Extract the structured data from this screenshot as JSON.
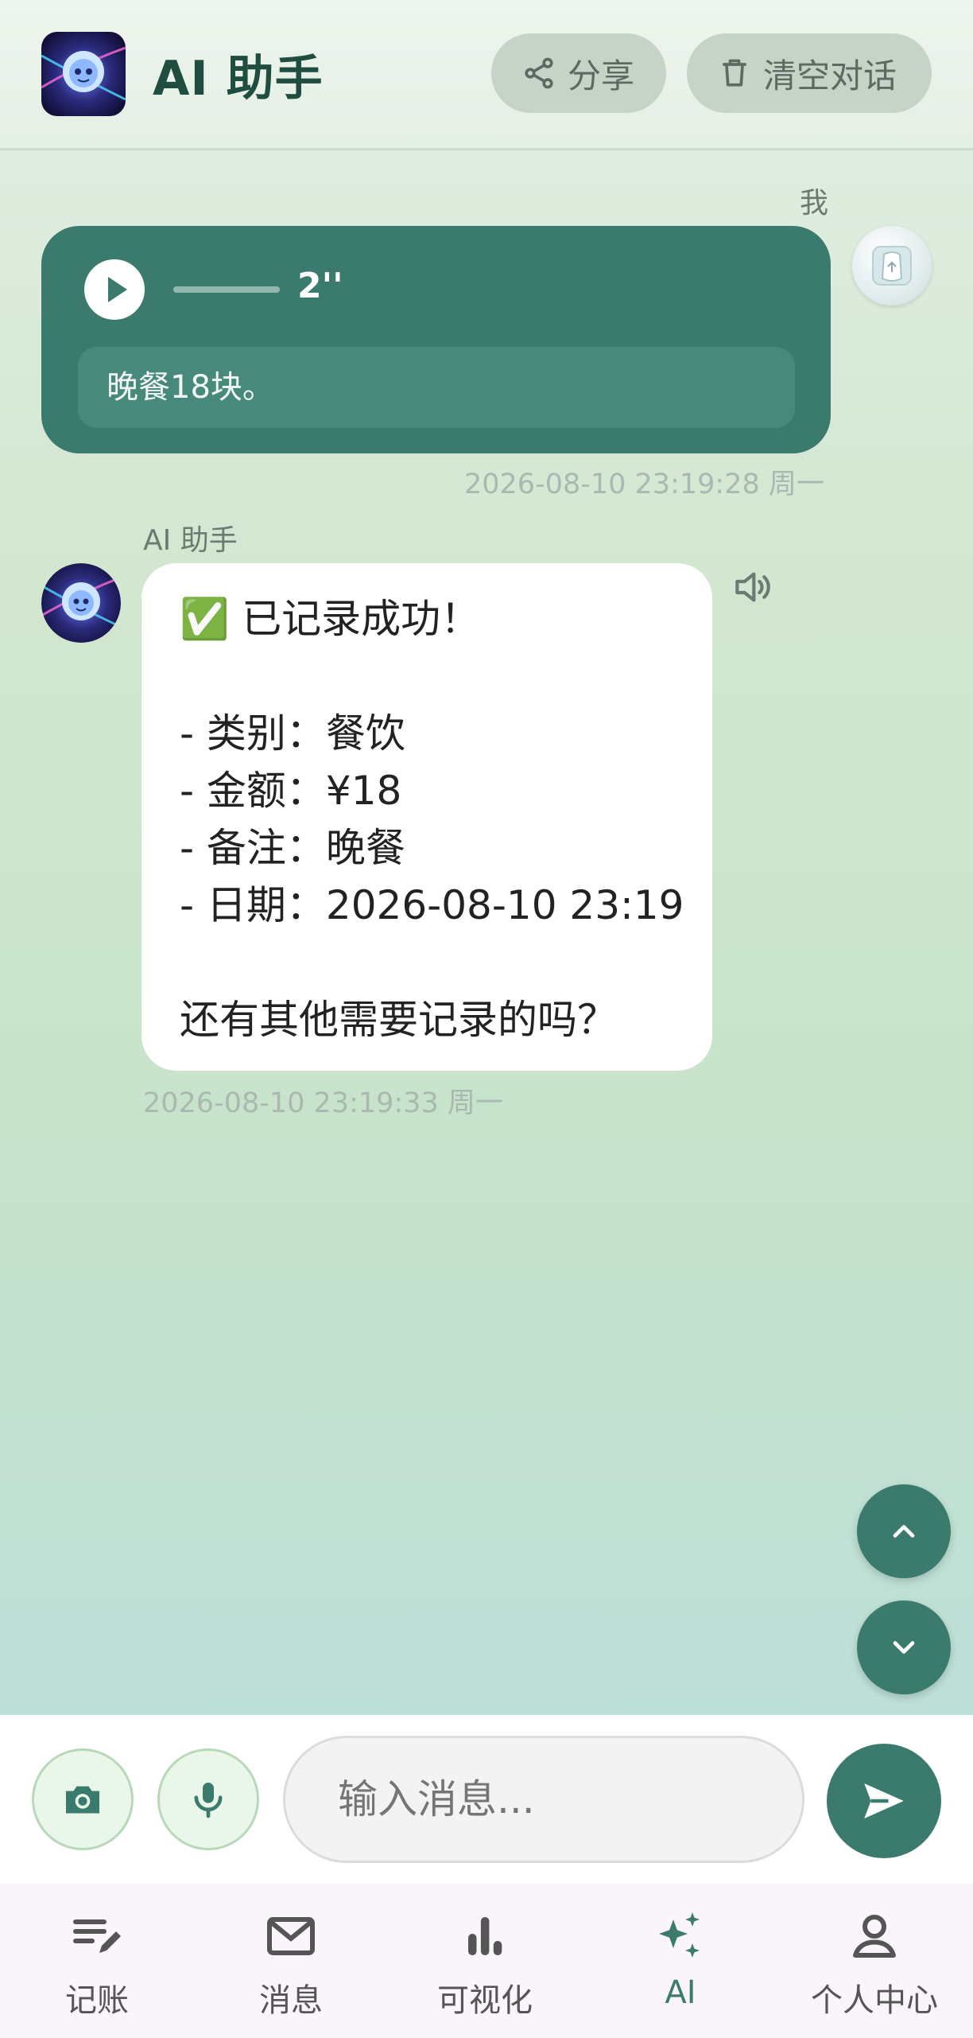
{
  "header": {
    "title": "AI 助手",
    "share_label": "分享",
    "clear_label": "清空对话"
  },
  "messages": {
    "user": {
      "name": "我",
      "voice_duration": "2''",
      "transcript": "晚餐18块。",
      "time": "2026-08-10 23:19:28 周一"
    },
    "assistant": {
      "name": "AI 助手",
      "lines": [
        "✅ 已记录成功！",
        "",
        "- 类别：餐饮",
        "- 金额：¥18",
        "- 备注：晚餐",
        "- 日期：2026-08-10 23:19",
        "",
        "还有其他需要记录的吗？"
      ],
      "time": "2026-08-10 23:19:33 周一"
    }
  },
  "input": {
    "placeholder": "输入消息..."
  },
  "nav": {
    "items": [
      {
        "label": "记账",
        "icon": "edit-list-icon"
      },
      {
        "label": "消息",
        "icon": "mail-icon"
      },
      {
        "label": "可视化",
        "icon": "bar-chart-icon"
      },
      {
        "label": "AI",
        "icon": "sparkle-icon"
      },
      {
        "label": "个人中心",
        "icon": "person-icon"
      }
    ],
    "active": "AI"
  },
  "colors": {
    "accent": "#3b7b6d",
    "header_title": "#1f4d3f"
  }
}
